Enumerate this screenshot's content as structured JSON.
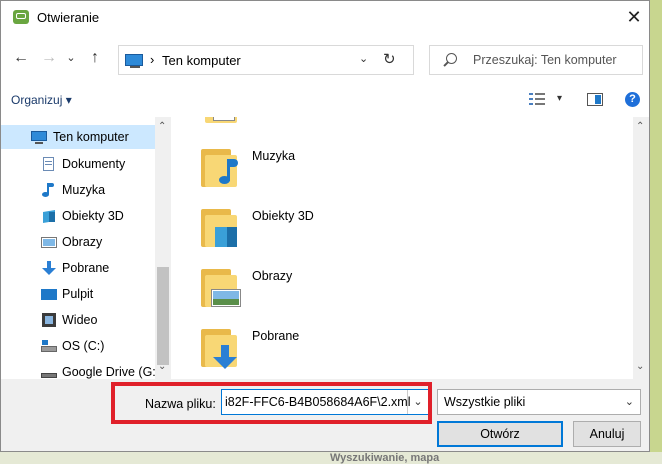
{
  "window": {
    "title": "Otwieranie",
    "close_glyph": "✕"
  },
  "nav": {
    "back": "←",
    "forward": "→",
    "history": "⌄",
    "up": "↑"
  },
  "address": {
    "separator": "›",
    "location": "Ten komputer",
    "dropdown": "⌄",
    "refresh": "↻"
  },
  "search": {
    "placeholder": "Przeszukaj: Ten komputer"
  },
  "toolbar": {
    "organize_label": "Organizuj ▾",
    "view_dropdown": "▾",
    "help_label": "?"
  },
  "sidebar": {
    "items": [
      {
        "label": "Ten komputer",
        "icon": "pc-icon",
        "selected": true
      },
      {
        "label": "Dokumenty",
        "icon": "documents-icon"
      },
      {
        "label": "Muzyka",
        "icon": "music-icon"
      },
      {
        "label": "Obiekty 3D",
        "icon": "cube-3d-icon"
      },
      {
        "label": "Obrazy",
        "icon": "pictures-icon"
      },
      {
        "label": "Pobrane",
        "icon": "download-icon"
      },
      {
        "label": "Pulpit",
        "icon": "desktop-icon"
      },
      {
        "label": "Wideo",
        "icon": "video-icon"
      },
      {
        "label": "OS (C:)",
        "icon": "drive-icon"
      },
      {
        "label": "Google Drive (G:",
        "icon": "google-drive-icon"
      }
    ],
    "scroll_up": "⌃",
    "scroll_down": "⌄"
  },
  "content": {
    "folders": [
      {
        "label": "Muzyka",
        "icon": "music-folder-icon"
      },
      {
        "label": "Obiekty 3D",
        "icon": "objects3d-folder-icon"
      },
      {
        "label": "Obrazy",
        "icon": "pictures-folder-icon"
      },
      {
        "label": "Pobrane",
        "icon": "downloads-folder-icon"
      }
    ],
    "scroll_up": "⌃",
    "scroll_down": "⌄"
  },
  "bottom": {
    "filename_label": "Nazwa pliku:",
    "filename_value": "i82F-FFC6-B4B058684A6F\\2.xml",
    "filename_dropdown": "⌄",
    "filetype_value": "Wszystkie pliki",
    "filetype_dropdown": "⌄",
    "open_button": "Otwórz",
    "cancel_button": "Anuluj"
  },
  "background": {
    "bottom_text": "Wyszukiwanie, mapa"
  },
  "colors": {
    "accent": "#0078d7",
    "highlight": "#e0202a",
    "selected": "#cce8ff"
  }
}
